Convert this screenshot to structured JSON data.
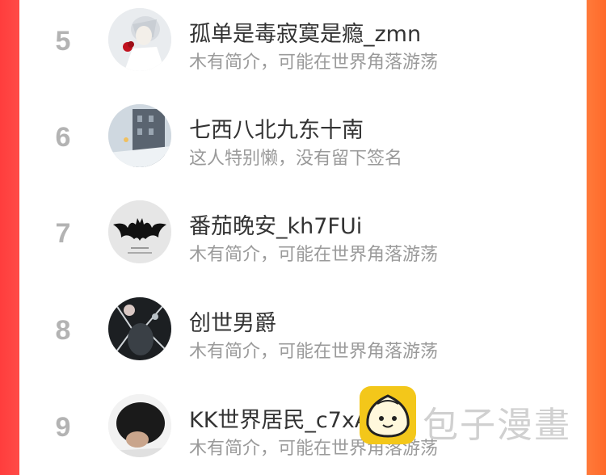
{
  "rows": [
    {
      "rank": "5",
      "name": "孤单是毒寂寞是瘾_zmn",
      "bio": "木有简介，可能在世界角落游荡",
      "avatar_icon": "anime-boy-rose-avatar"
    },
    {
      "rank": "6",
      "name": "七西八北九东十南",
      "bio": "这人特别懒，没有留下签名",
      "avatar_icon": "winter-street-avatar"
    },
    {
      "rank": "7",
      "name": "番茄晚安_kh7FUi",
      "bio": "木有简介，可能在世界角落游荡",
      "avatar_icon": "batman-logo-avatar"
    },
    {
      "rank": "8",
      "name": "创世男爵",
      "bio": "木有简介，可能在世界角落游荡",
      "avatar_icon": "dark-fantasy-avatar"
    },
    {
      "rank": "9",
      "name": "KK世界居民_c7xA30",
      "bio": "木有简介，可能在世界角落游荡",
      "avatar_icon": "person-photo-avatar"
    }
  ],
  "watermark": {
    "text": "包子漫畫",
    "logo_icon": "baozi-logo-icon"
  },
  "colors": {
    "side_left": "#ff3d3d",
    "side_right": "#ff7a3a",
    "rank": "#b3b3b3",
    "name": "#333333",
    "bio": "#9a9a9a",
    "logo": "#f3c71a"
  }
}
